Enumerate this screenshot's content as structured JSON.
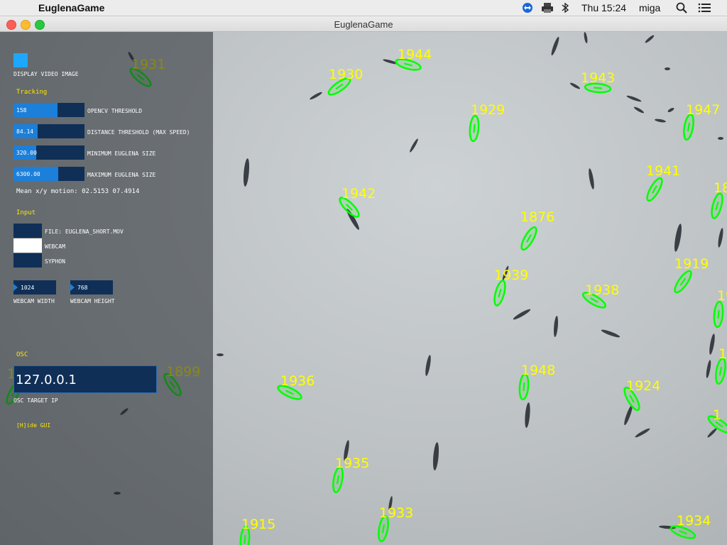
{
  "menubar": {
    "app_name": "EuglenaGame",
    "clock": "Thu 15:24",
    "user": "miga"
  },
  "window": {
    "title": "EuglenaGame"
  },
  "colors": {
    "accent": "#1c7fd9",
    "panel": "#0f2f57",
    "section": "#ffe600",
    "track": "#00ff00",
    "label": "#ffff00"
  },
  "gui": {
    "display_video_label": "DISPLAY VIDEO IMAGE",
    "display_video_on": true,
    "tracking_section": "Tracking",
    "sliders": [
      {
        "value_text": "158",
        "label": "OPENCV THRESHOLD",
        "fill": 0.62
      },
      {
        "value_text": "84.14",
        "label": "DISTANCE THRESHOLD (MAX SPEED)",
        "fill": 0.34
      },
      {
        "value_text": "320.00",
        "label": "MINIMUM EUGLENA SIZE",
        "fill": 0.32
      },
      {
        "value_text": "6300.00",
        "label": "MAXIMUM EUGLENA SIZE",
        "fill": 0.63
      }
    ],
    "mean_motion": "Mean x/y motion: 02.5153 07.4914",
    "input_section": "Input",
    "inputs": [
      {
        "label": "FILE: EUGLENA_SHORT.MOV",
        "active": false
      },
      {
        "label": "WEBCAM",
        "active": true
      },
      {
        "label": "SYPHON",
        "active": false
      }
    ],
    "webcam_width": {
      "value": "1024",
      "label": "WEBCAM WIDTH"
    },
    "webcam_height": {
      "value": "768",
      "label": "WEBCAM HEIGHT"
    },
    "osc_section": "OSC",
    "osc_ip": "127.0.0.1",
    "osc_label": "OSC TARGET IP",
    "hide_gui": "[H]ide GUI"
  },
  "tracks": [
    {
      "id": "1931"
    },
    {
      "id": "1944"
    },
    {
      "id": "1930"
    },
    {
      "id": "1943"
    },
    {
      "id": "1929"
    },
    {
      "id": "1947"
    },
    {
      "id": "1941"
    },
    {
      "id": "18"
    },
    {
      "id": "1942"
    },
    {
      "id": "1876"
    },
    {
      "id": "1919"
    },
    {
      "id": "1939"
    },
    {
      "id": "1938"
    },
    {
      "id": "19"
    },
    {
      "id": "1948"
    },
    {
      "id": "1"
    },
    {
      "id": "1899"
    },
    {
      "id": "1936"
    },
    {
      "id": "1924"
    },
    {
      "id": "1"
    },
    {
      "id": "1935"
    },
    {
      "id": "1933"
    },
    {
      "id": "1915"
    },
    {
      "id": "1934"
    },
    {
      "id": "1"
    }
  ]
}
